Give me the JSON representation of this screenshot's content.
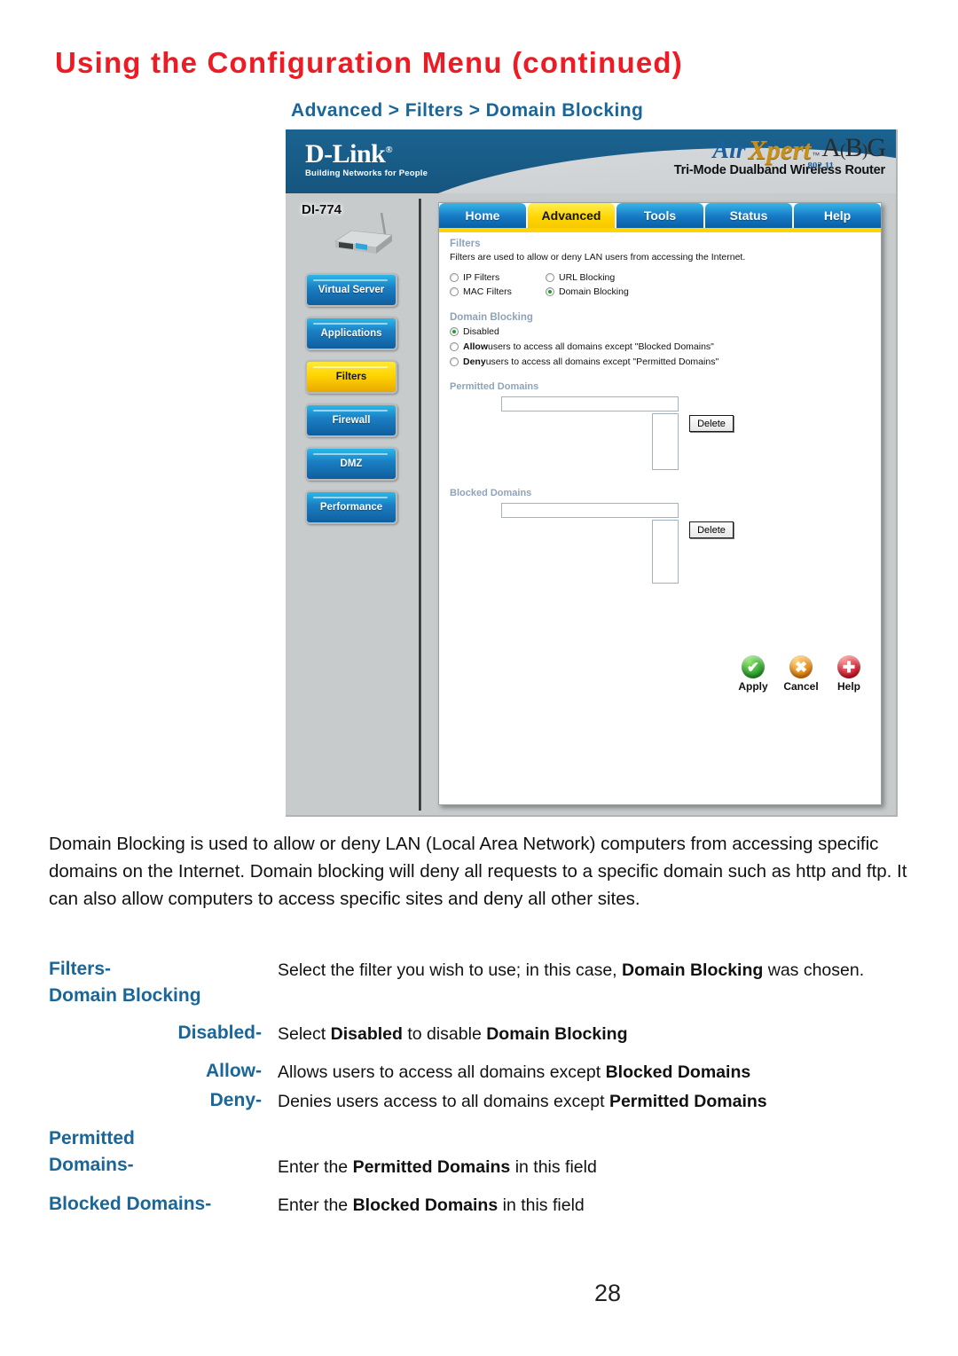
{
  "page": {
    "title": "Using the Configuration Menu (continued)",
    "breadcrumb": "Advanced > Filters > Domain Blocking",
    "page_number": "28",
    "title_color": "#ed1c24",
    "accent_color": "#1a6699"
  },
  "screenshot": {
    "brand": {
      "name": "D-Link",
      "tm": "®",
      "tagline": "Building Networks for People",
      "product_air": "Air",
      "product_xpert": "Xpert",
      "product_tm": "™",
      "standard": "802.11",
      "abg_a": "A",
      "abg_b": "B",
      "abg_g": "G",
      "subtitle": "Tri-Mode Dualband Wireless Router"
    },
    "sidebar": {
      "model": "DI-774",
      "buttons": [
        {
          "label": "Virtual Server",
          "active": false
        },
        {
          "label": "Applications",
          "active": false
        },
        {
          "label": "Filters",
          "active": true
        },
        {
          "label": "Firewall",
          "active": false
        },
        {
          "label": "DMZ",
          "active": false
        },
        {
          "label": "Performance",
          "active": false
        }
      ]
    },
    "tabs": [
      {
        "label": "Home",
        "active": false
      },
      {
        "label": "Advanced",
        "active": true
      },
      {
        "label": "Tools",
        "active": false
      },
      {
        "label": "Status",
        "active": false
      },
      {
        "label": "Help",
        "active": false
      }
    ],
    "filters": {
      "heading": "Filters",
      "description": "Filters are used to allow or deny LAN users from accessing the Internet.",
      "options_col1": [
        {
          "label": "IP Filters",
          "selected": false
        },
        {
          "label": "MAC Filters",
          "selected": false
        }
      ],
      "options_col2": [
        {
          "label": "URL Blocking",
          "selected": false
        },
        {
          "label": "Domain Blocking",
          "selected": true
        }
      ]
    },
    "domain_blocking": {
      "heading": "Domain Blocking",
      "options": [
        {
          "bold": "",
          "label": "Disabled",
          "selected": true
        },
        {
          "bold": "Allow",
          "label": " users to access all domains except \"Blocked Domains\"",
          "selected": false
        },
        {
          "bold": "Deny",
          "label": " users to access all domains except \"Permitted Domains\"",
          "selected": false
        }
      ]
    },
    "permitted_domains": {
      "label": "Permitted Domains",
      "input_value": "",
      "delete_label": "Delete"
    },
    "blocked_domains": {
      "label": "Blocked Domains",
      "input_value": "",
      "delete_label": "Delete"
    },
    "actions": [
      {
        "label": "Apply",
        "icon": "check-icon",
        "glyph": "✔",
        "color": "#1f9a25"
      },
      {
        "label": "Cancel",
        "icon": "x-icon",
        "glyph": "✖",
        "color": "#e07a08"
      },
      {
        "label": "Help",
        "icon": "plus-icon",
        "glyph": "✚",
        "color": "#cc1326"
      }
    ]
  },
  "body_text": "Domain Blocking is used to allow or deny LAN (Local Area Network) computers from accessing specific domains on the Internet. Domain blocking will deny all requests to a specific domain such as http and ftp. It can also allow computers to access specific sites and deny all other sites.",
  "definitions": [
    {
      "term": "Filters-",
      "term2": "Domain Blocking",
      "term_align": "left",
      "desc_plain1": "Select the filter you wish to use; in this case, ",
      "desc_bold1": "Domain Blocking",
      "desc_plain2": " was chosen."
    },
    {
      "term": "Disabled-",
      "term_align": "right",
      "desc_plain1": "Select ",
      "desc_bold1": "Disabled",
      "desc_plain2": " to disable ",
      "desc_bold2": "Domain Blocking"
    },
    {
      "term": "Allow-",
      "term_align": "right",
      "desc_plain1": "Allows users to access all domains except ",
      "desc_bold1": "Blocked Domains"
    },
    {
      "term": "Deny-",
      "term_align": "right",
      "desc_plain1": "Denies users  access to  all domains except ",
      "desc_bold1": "Permitted Domains"
    },
    {
      "term": "Permitted",
      "term2": "Domains-",
      "term_align": "left",
      "desc_plain1": "Enter the ",
      "desc_bold1": "Permitted Domains",
      "desc_plain2": " in this field"
    },
    {
      "term": "Blocked Domains-",
      "term_align": "left",
      "desc_plain1": "Enter the ",
      "desc_bold1": "Blocked Domains",
      "desc_plain2": " in this field"
    }
  ]
}
